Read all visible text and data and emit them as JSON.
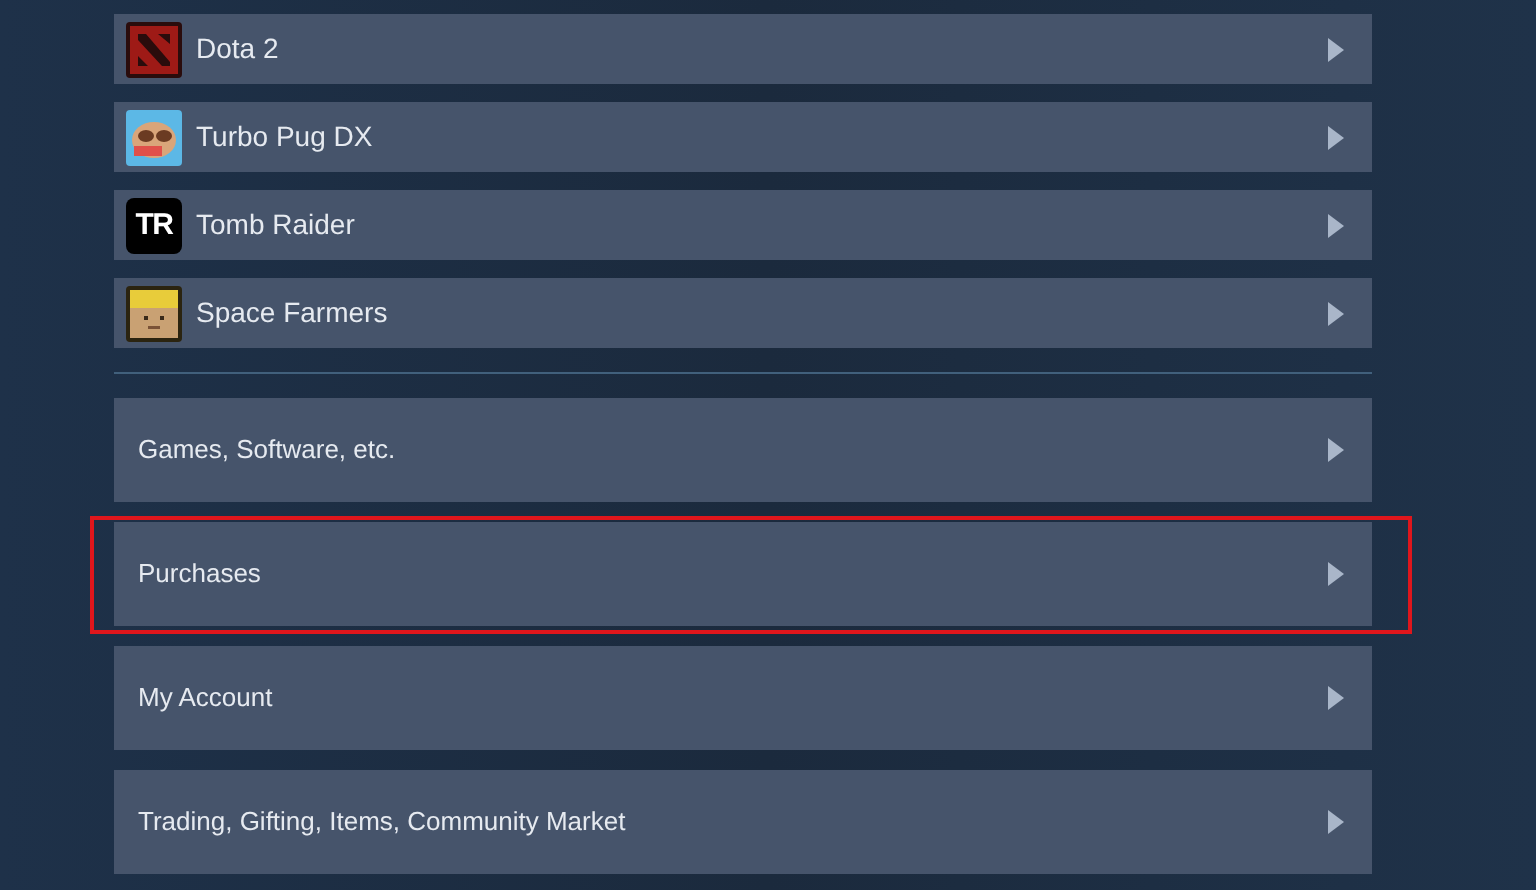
{
  "games": [
    {
      "name": "Dota 2",
      "kind": "emblem"
    },
    {
      "name": "Turbo Pug DX",
      "kind": "pug"
    },
    {
      "name": "Tomb Raider",
      "kind": "letters",
      "icon_text": "TR"
    },
    {
      "name": "Space Farmers",
      "kind": "face"
    }
  ],
  "categories": [
    {
      "label": "Games, Software, etc.",
      "highlighted": false
    },
    {
      "label": "Purchases",
      "highlighted": true
    },
    {
      "label": "My Account",
      "highlighted": false
    },
    {
      "label": "Trading, Gifting, Items, Community Market",
      "highlighted": false
    }
  ]
}
